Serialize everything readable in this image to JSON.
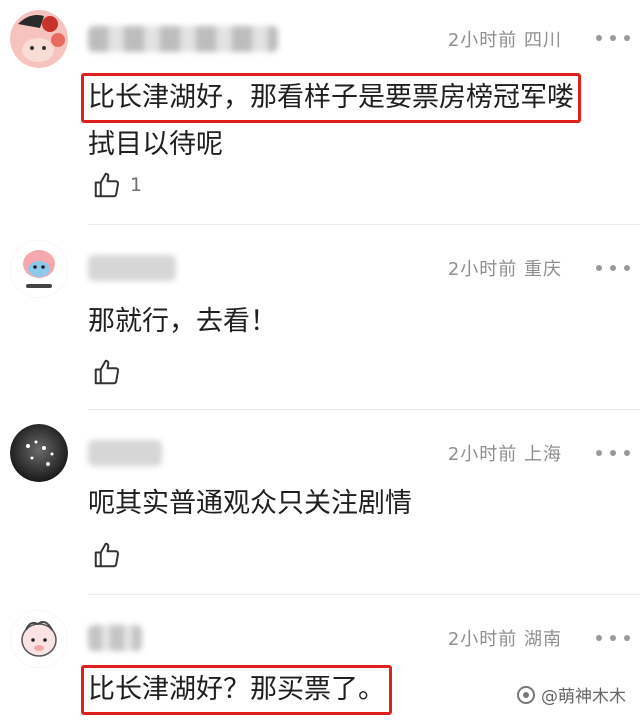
{
  "comments": [
    {
      "time": "2小时前",
      "location": "四川",
      "text_highlight": "比长津湖好，那看样子是要票房榜冠军喽",
      "text_rest": "拭目以待呢",
      "like_count": "1",
      "avatar_color": "#f6c3bf"
    },
    {
      "time": "2小时前",
      "location": "重庆",
      "text": "那就行，去看！",
      "like_count": "",
      "avatar_color": "#f7b6b9"
    },
    {
      "time": "2小时前",
      "location": "上海",
      "text": "呃其实普通观众只关注剧情",
      "like_count": "",
      "avatar_color": "#2b2b2b"
    },
    {
      "time": "2小时前",
      "location": "湖南",
      "text_highlight": "比长津湖好？那买票了。",
      "like_count": "",
      "avatar_color": "#f5d6d6"
    }
  ],
  "watermark": "@萌神木木",
  "colors": {
    "highlight_border": "#e0201f",
    "meta_text": "#8f8f8f"
  }
}
